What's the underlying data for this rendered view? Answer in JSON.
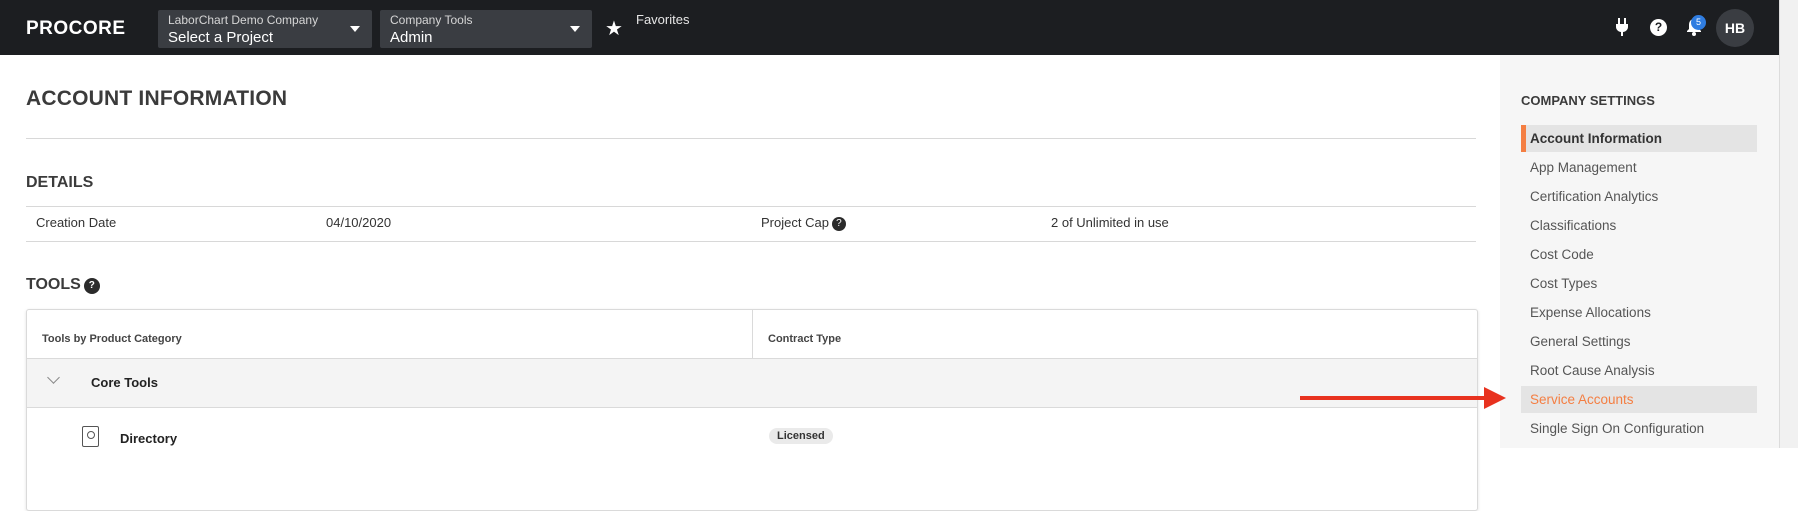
{
  "topbar": {
    "logo": "PROCORE",
    "company_selector": {
      "caption": "LaborChart Demo Company",
      "value": "Select a Project"
    },
    "tools_selector": {
      "caption": "Company Tools",
      "value": "Admin"
    },
    "favorites_label": "Favorites",
    "icons": [
      "plug-icon",
      "help-icon",
      "bell-icon"
    ],
    "help_glyph": "?",
    "notification_count": "5",
    "avatar_initials": "HB"
  },
  "main": {
    "title": "ACCOUNT INFORMATION",
    "details": {
      "heading": "DETAILS",
      "creation_date_label": "Creation Date",
      "creation_date_value": "04/10/2020",
      "project_cap_label": "Project Cap",
      "project_cap_value": "2 of Unlimited in use"
    },
    "tools": {
      "heading": "TOOLS",
      "columns": [
        "Tools by Product Category",
        "Contract Type"
      ],
      "category": "Core Tools",
      "rows": [
        {
          "tool": "Directory",
          "contract": "Licensed"
        }
      ]
    }
  },
  "sidebar": {
    "heading": "COMPANY SETTINGS",
    "items": [
      {
        "label": "Account Information",
        "state": "active"
      },
      {
        "label": "App Management",
        "state": ""
      },
      {
        "label": "Certification Analytics",
        "state": ""
      },
      {
        "label": "Classifications",
        "state": ""
      },
      {
        "label": "Cost Code",
        "state": ""
      },
      {
        "label": "Cost Types",
        "state": ""
      },
      {
        "label": "Expense Allocations",
        "state": ""
      },
      {
        "label": "General Settings",
        "state": ""
      },
      {
        "label": "Root Cause Analysis",
        "state": ""
      },
      {
        "label": "Service Accounts",
        "state": "highlight"
      },
      {
        "label": "Single Sign On Configuration",
        "state": ""
      }
    ]
  },
  "colors": {
    "topbar_bg": "#1c1e21",
    "brand_orange": "#f47e42",
    "annotation_arrow": "#e8321f",
    "notification_blue": "#2f7de1"
  }
}
